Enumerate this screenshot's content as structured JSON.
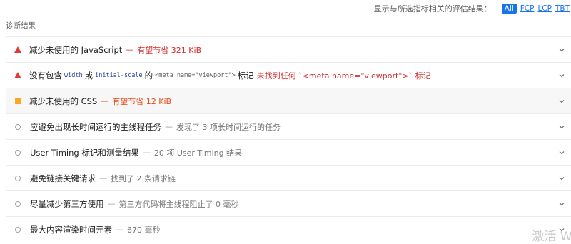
{
  "filter": {
    "label": "显示与所选指标相关的评估结果：",
    "chips": [
      "All",
      "FCP",
      "LCP",
      "TBT"
    ]
  },
  "section_title": "诊断结果",
  "audits": [
    {
      "status": "fail",
      "title": "减少未使用的 JavaScript",
      "sep": "—",
      "display": "有望节省 321 KiB",
      "display_color": "#d32f2f"
    },
    {
      "status": "fail",
      "title_prefix": "没有包含",
      "code1": "width",
      "word_or": "或",
      "code2": "initial-scale",
      "word_of": "的",
      "code3": "<meta name=\"viewport\">",
      "title_suffix": "标记",
      "display": "未找到任何 `<meta name=\"viewport\">` 标记",
      "display_color": "#d32f2f"
    },
    {
      "status": "average",
      "title": "减少未使用的 CSS",
      "sep": "—",
      "display": "有望节省 12 KiB",
      "display_color": "#e64a19"
    },
    {
      "status": "informative",
      "title": "应避免出现长时间运行的主线程任务",
      "sep": "—",
      "display": "发现了 3 项长时间运行的任务"
    },
    {
      "status": "informative",
      "title": "User Timing 标记和测量结果",
      "sep": "—",
      "display": "20 项 User Timing 结果"
    },
    {
      "status": "informative",
      "title": "避免链接关键请求",
      "sep": "—",
      "display": "找到了 2 条请求链"
    },
    {
      "status": "informative",
      "title": "尽量减少第三方使用",
      "sep": "—",
      "display": "第三方代码将主线程阻止了 0 毫秒"
    },
    {
      "status": "informative",
      "title": "最大内容渲染时间元素",
      "sep": "—",
      "display": "670 毫秒"
    }
  ],
  "icons": {
    "fail": "red-triangle-icon",
    "average": "orange-square-icon",
    "informative": "grey-circle-icon",
    "expand": "chevron-down-icon"
  },
  "watermark": "激活 Wi"
}
